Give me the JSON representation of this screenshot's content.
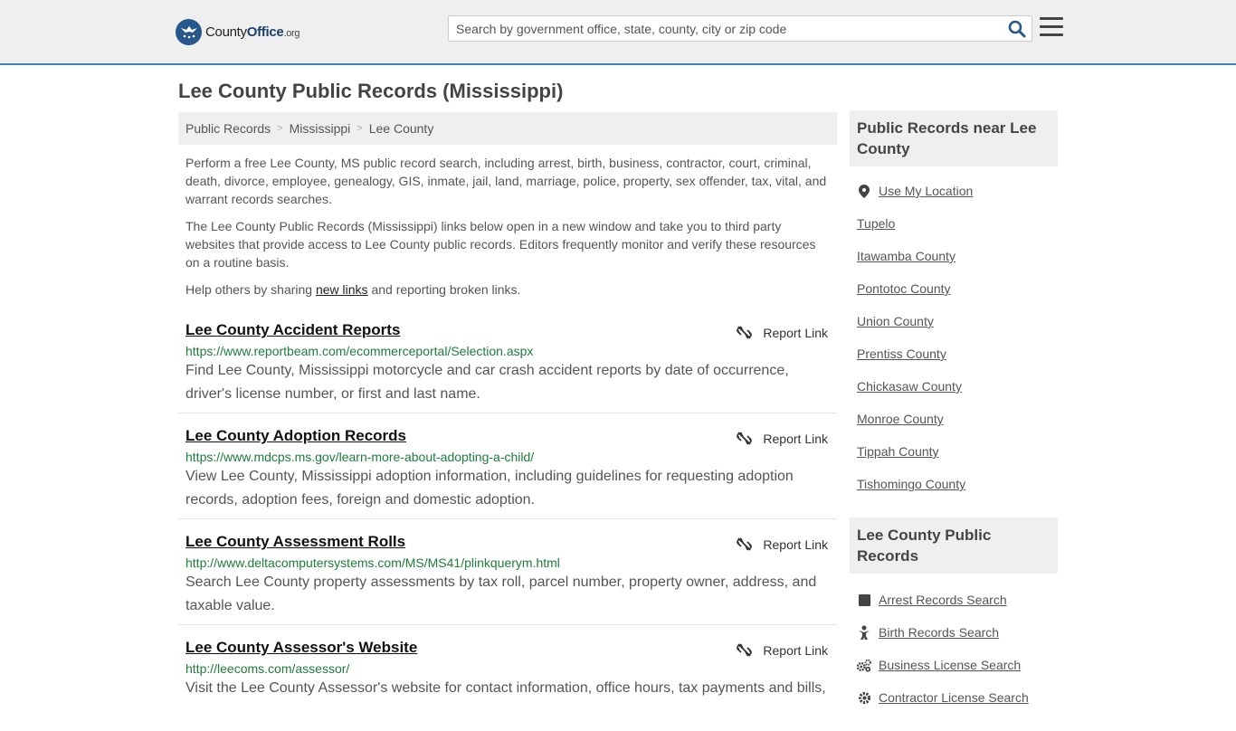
{
  "header": {
    "logo": {
      "county": "County",
      "office": "Office",
      "org": ".org"
    },
    "search_placeholder": "Search by government office, state, county, city or zip code"
  },
  "page_title": "Lee County Public Records (Mississippi)",
  "breadcrumb": [
    "Public Records",
    "Mississippi",
    "Lee County"
  ],
  "intro": {
    "p1": "Perform a free Lee County, MS public record search, including arrest, birth, business, contractor, court, criminal, death, divorce, employee, genealogy, GIS, inmate, jail, land, marriage, police, property, sex offender, tax, vital, and warrant records searches.",
    "p2": "The Lee County Public Records (Mississippi) links below open in a new window and take you to third party websites that provide access to Lee County public records. Editors frequently monitor and verify these resources on a routine basis.",
    "p3_before": "Help others by sharing ",
    "p3_link": "new links",
    "p3_after": " and reporting broken links."
  },
  "report_label": "Report Link",
  "entries": [
    {
      "title": "Lee County Accident Reports",
      "url": "https://www.reportbeam.com/ecommerceportal/Selection.aspx",
      "desc": "Find Lee County, Mississippi motorcycle and car crash accident reports by date of occurrence, driver's license number, or first and last name."
    },
    {
      "title": "Lee County Adoption Records",
      "url": "https://www.mdcps.ms.gov/learn-more-about-adopting-a-child/",
      "desc": "View Lee County, Mississippi adoption information, including guidelines for requesting adoption records, adoption fees, foreign and domestic adoption."
    },
    {
      "title": "Lee County Assessment Rolls",
      "url": "http://www.deltacomputersystems.com/MS/MS41/plinkquerym.html",
      "desc": "Search Lee County property assessments by tax roll, parcel number, property owner, address, and taxable value."
    },
    {
      "title": "Lee County Assessor's Website",
      "url": "http://leecoms.com/assessor/",
      "desc": "Visit the Lee County Assessor's website for contact information, office hours, tax payments and bills,"
    }
  ],
  "sidebar": {
    "near_title": "Public Records near Lee County",
    "use_location": "Use My Location",
    "near_links": [
      "Tupelo",
      "Itawamba County",
      "Pontotoc County",
      "Union County",
      "Prentiss County",
      "Chickasaw County",
      "Monroe County",
      "Tippah County",
      "Tishomingo County"
    ],
    "records_title": "Lee County Public Records",
    "records_links": [
      {
        "label": "Arrest Records Search",
        "icon": "square-icon"
      },
      {
        "label": "Birth Records Search",
        "icon": "baby-icon"
      },
      {
        "label": "Business License Search",
        "icon": "cogs-icon"
      },
      {
        "label": "Contractor License Search",
        "icon": "gear-icon"
      }
    ]
  }
}
